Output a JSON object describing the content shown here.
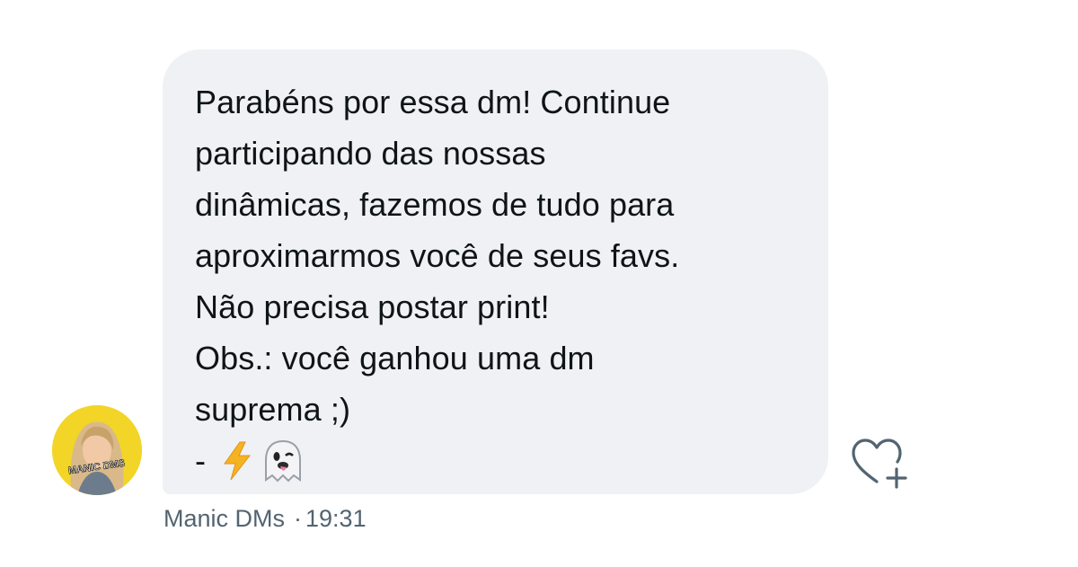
{
  "message": {
    "lines": [
      "Parabéns por essa dm! Continue",
      "participando das nossas",
      "dinâmicas, fazemos de tudo para",
      "aproximarmos você de seus favs.",
      "Não precisa postar print!",
      "Obs.: você ganhou uma dm",
      "suprema ;)"
    ],
    "emoji_line_dash": "-",
    "emojis": [
      "lightning-emoji",
      "ghost-emoji"
    ]
  },
  "avatar": {
    "label": "MANIC DMS",
    "color": "#f2d526"
  },
  "meta": {
    "sender": "Manic DMs",
    "separator": "·",
    "time": "19:31"
  },
  "colors": {
    "bubble": "#eff1f4",
    "text": "#0f1419",
    "meta": "#536471",
    "icon": "#536471"
  },
  "icons": {
    "reaction": "heart-plus-icon"
  }
}
